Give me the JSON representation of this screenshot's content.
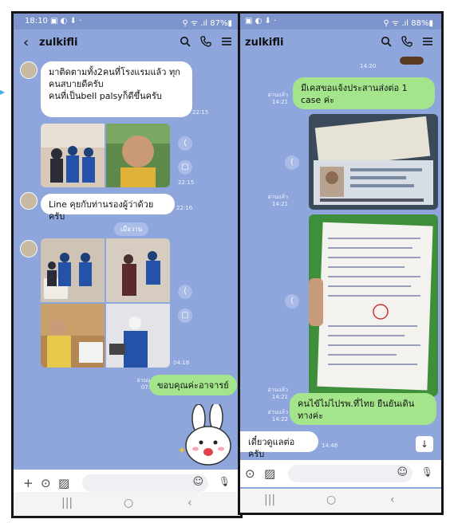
{
  "left": {
    "status": {
      "time": "18:10 ▣ ◐ ⬇ ·",
      "icons": "⚲ ᯤ .ıl 87%▮"
    },
    "header": {
      "back": "‹",
      "title": "zulkifli"
    },
    "messages": {
      "m1_text": "มาติดตามทั้ง2คนที่โรงแรมแล้ว ทุกคนสบายดีครับ\nคนที่เป็นbell palsyก็ดีขึ้นครับ",
      "m1_time": "22:15",
      "photo1_time": "22:15",
      "m2_text": "Line คุยกับท่านรองผู้ว่าด้วยครับ",
      "m2_time": "22:16",
      "date_sep": "เมื่อวาน",
      "photo2_time": "04:18",
      "m3_read": "อ่านแล้ว",
      "m3_time": "07:43",
      "m3_text": "ขอบคุณค่ะอาจารย์"
    },
    "input": {
      "plus": "+",
      "camera": "⊙",
      "image": "▨",
      "emoji": "☺",
      "mic": "🎙"
    },
    "nav": {
      "recent": "|||",
      "home": "○",
      "back": "‹"
    }
  },
  "right": {
    "status": {
      "time": "▣ ◐ ⬇ ·",
      "icons": "⚲ ᯤ .ıl 88%▮"
    },
    "header": {
      "title": "zulkifli"
    },
    "messages": {
      "top_time": "14:20",
      "r1_read": "อ่านแล้ว",
      "r1_time": "14:21",
      "r1_text": "มีเคสขอแจ้งประสานส่งต่อ 1 case ค่ะ",
      "p1_read": "อ่านแล้ว",
      "p1_time": "14:21",
      "p2_read": "อ่านแล้ว",
      "p2_time": "14:21",
      "r2_read": "อ่านแล้ว",
      "r2_time": "14:22",
      "r2_text": "คนไข้ไม่ไปรพ.ที่ไทย ยืนยันเดินทางค่ะ",
      "r3_text": "เดี๋ยวดูแลต่อครับ",
      "r3_time": "14:48",
      "scroll_down": "↓"
    },
    "input": {
      "camera": "⊙",
      "image": "▨",
      "emoji": "☺",
      "mic": "🎙"
    },
    "nav": {
      "recent": "|||",
      "home": "○",
      "back": "‹"
    }
  },
  "colors": {
    "chat_bg": "#8ea6dc",
    "out_bubble": "#a4e58c",
    "in_bubble": "#ffffff"
  }
}
